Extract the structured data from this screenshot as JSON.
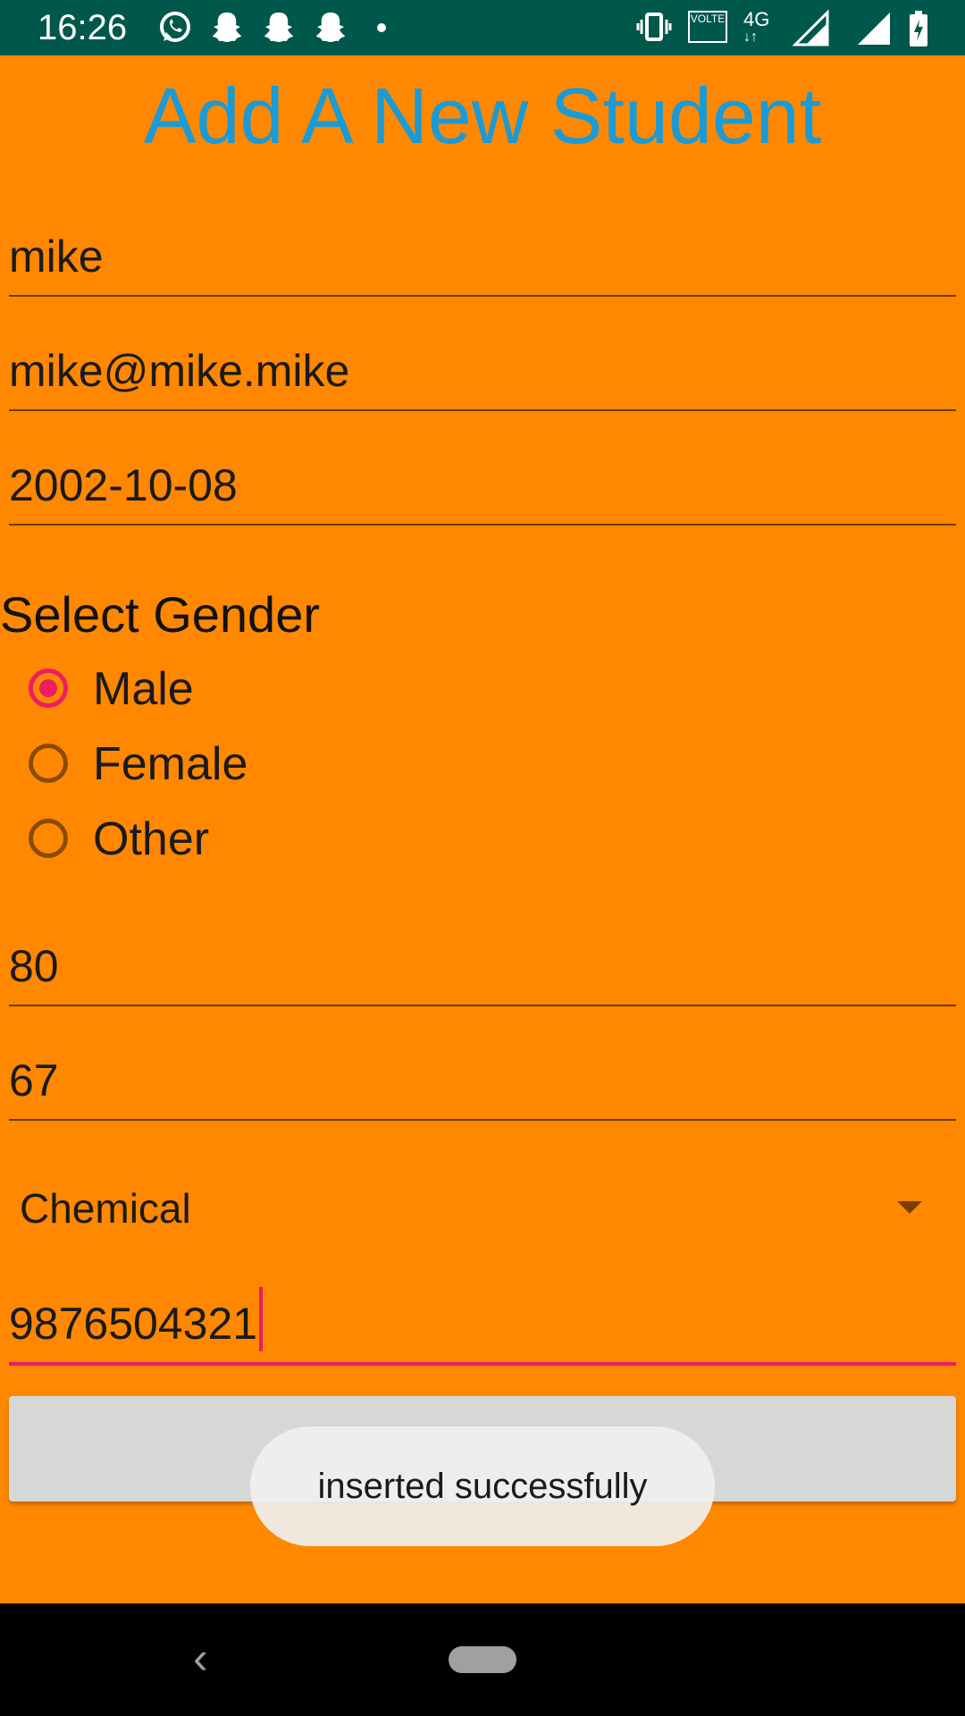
{
  "status_bar": {
    "time": "16:26",
    "icons": [
      "whatsapp-icon",
      "snapchat-icon",
      "snapchat-icon",
      "snapchat-icon",
      "dot-icon",
      "vibrate-icon",
      "volte-icon",
      "4g-icon",
      "signal-icon",
      "signal-icon",
      "battery-charging-icon"
    ],
    "volte_label": "VOLTE",
    "network_label": "4G"
  },
  "page": {
    "title": "Add A New Student"
  },
  "form": {
    "name": "mike",
    "email": "mike@mike.mike",
    "dob": "2002-10-08",
    "gender_label": "Select Gender",
    "gender_options": [
      "Male",
      "Female",
      "Other"
    ],
    "gender_selected": "Male",
    "marks1": "80",
    "marks2": "67",
    "department": "Chemical",
    "phone": "9876504321",
    "submit_label": "SUBMIT"
  },
  "toast": {
    "message": "inserted successfully"
  },
  "colors": {
    "background": "#ff8800",
    "title": "#1a9bd6",
    "accent": "#e91e63",
    "status_bar": "#00574b"
  },
  "nav_bar": {
    "icons": [
      "back-icon",
      "home-pill-icon"
    ]
  }
}
